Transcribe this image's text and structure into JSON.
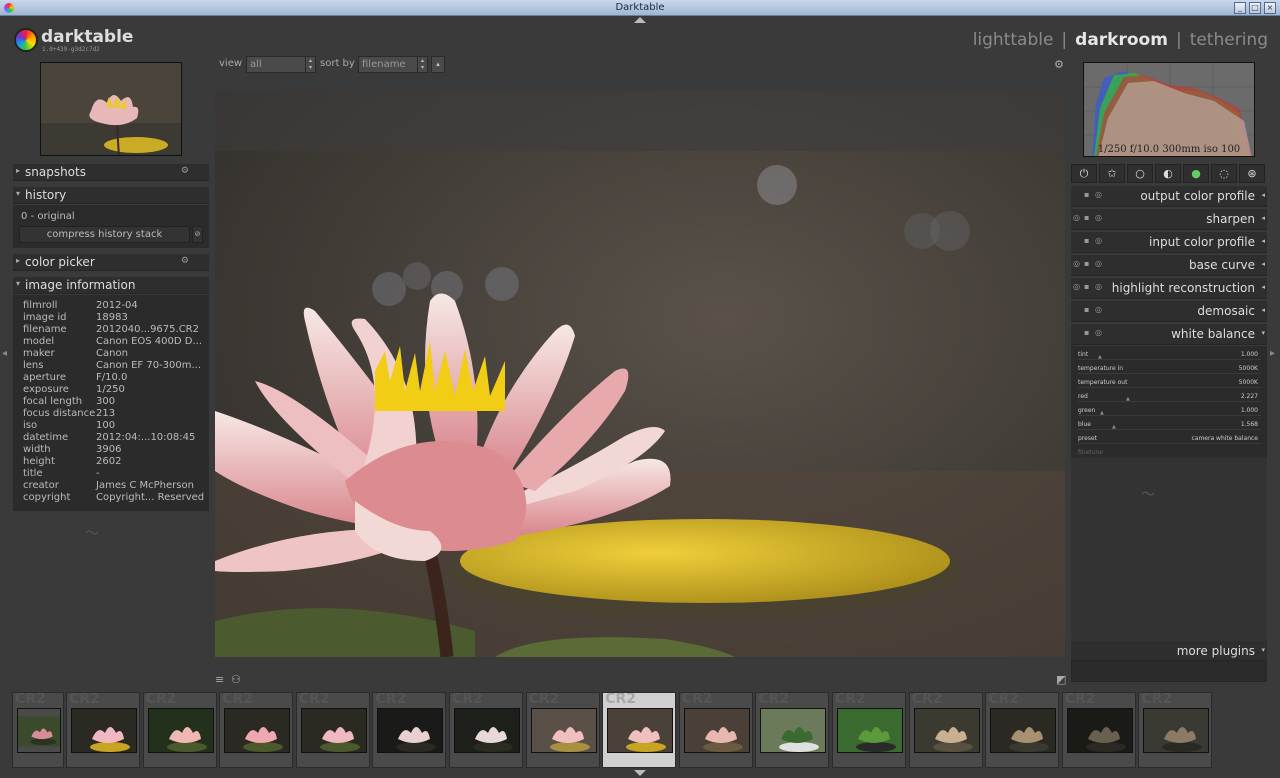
{
  "window": {
    "title": "Darktable"
  },
  "logo": {
    "name": "darktable",
    "version": "1.0+439-g3d2c7d2"
  },
  "views": [
    {
      "label": "lighttable",
      "active": false
    },
    {
      "label": "darkroom",
      "active": true
    },
    {
      "label": "tethering",
      "active": false
    }
  ],
  "toolbar": {
    "view_label": "view",
    "view_value": "all",
    "sort_label": "sort by",
    "sort_value": "filename"
  },
  "left_panels": {
    "snapshots": "snapshots",
    "history": "history",
    "history_item": "0 - original",
    "compress": "compress history stack",
    "color_picker": "color picker",
    "image_information": "image information"
  },
  "image_info": [
    {
      "k": "filmroll",
      "v": "2012-04"
    },
    {
      "k": "image id",
      "v": "18983"
    },
    {
      "k": "filename",
      "v": "2012040...9675.CR2"
    },
    {
      "k": "model",
      "v": "Canon EOS 400D D..."
    },
    {
      "k": "maker",
      "v": "Canon"
    },
    {
      "k": "lens",
      "v": "Canon EF 70-300m..."
    },
    {
      "k": "aperture",
      "v": "F/10.0"
    },
    {
      "k": "exposure",
      "v": "1/250"
    },
    {
      "k": "focal length",
      "v": "300"
    },
    {
      "k": "focus distance",
      "v": "213"
    },
    {
      "k": "iso",
      "v": "100"
    },
    {
      "k": "datetime",
      "v": "2012:04:...10:08:45"
    },
    {
      "k": "width",
      "v": "3906"
    },
    {
      "k": "height",
      "v": "2602"
    },
    {
      "k": "title",
      "v": "-"
    },
    {
      "k": "creator",
      "v": "James C McPherson"
    },
    {
      "k": "copyright",
      "v": "Copyright... Reserved"
    }
  ],
  "histogram": {
    "exif": "1/250 f/10.0 300mm iso 100"
  },
  "module_groups": [
    "power-icon",
    "star-icon",
    "circle-icon",
    "half-circle-icon",
    "color-circle-icon",
    "shape-icon",
    "effect-icon"
  ],
  "modules": [
    {
      "label": "output color profile",
      "expanded": false
    },
    {
      "label": "sharpen",
      "expanded": false
    },
    {
      "label": "input color profile",
      "expanded": false
    },
    {
      "label": "base curve",
      "expanded": false
    },
    {
      "label": "highlight reconstruction",
      "expanded": false
    },
    {
      "label": "demosaic",
      "expanded": false
    },
    {
      "label": "white balance",
      "expanded": true
    }
  ],
  "white_balance": [
    {
      "k": "tint",
      "v": "1.000"
    },
    {
      "k": "temperature in",
      "v": "5000K"
    },
    {
      "k": "temperature out",
      "v": "5000K"
    },
    {
      "k": "red",
      "v": "2.227"
    },
    {
      "k": "green",
      "v": "1.000"
    },
    {
      "k": "blue",
      "v": "1.568"
    },
    {
      "k": "preset",
      "v": "camera white balance"
    },
    {
      "k": "finetune",
      "v": ""
    }
  ],
  "more_plugins": "more plugins",
  "filmstrip": {
    "ext": "CR2",
    "selected_index": 8,
    "count": 16
  },
  "colors": {
    "background": "#3a3a3a",
    "panel": "#2b2b2b",
    "header": "#2e2e2e",
    "text": "#dddddd",
    "selected_thumb": "#d0d0d0"
  }
}
